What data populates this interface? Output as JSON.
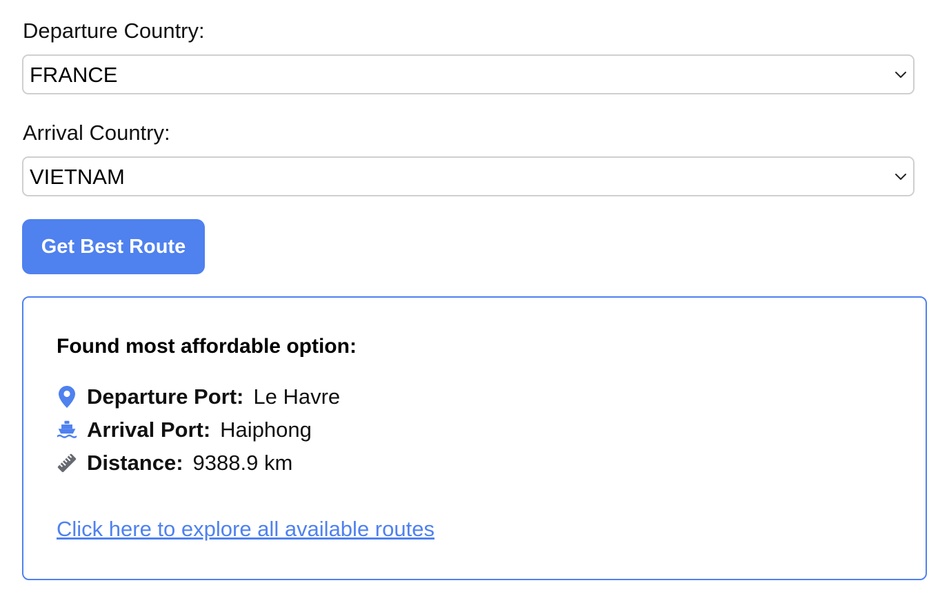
{
  "departure": {
    "label": "Departure Country:",
    "selected": "FRANCE"
  },
  "arrival": {
    "label": "Arrival Country:",
    "selected": "VIETNAM"
  },
  "actions": {
    "get_route_label": "Get Best Route"
  },
  "result": {
    "title": "Found most affordable option:",
    "departure_port": {
      "key": "Departure Port:",
      "value": "Le Havre",
      "icon": "map-pin-icon"
    },
    "arrival_port": {
      "key": "Arrival Port:",
      "value": "Haiphong",
      "icon": "ship-icon"
    },
    "distance": {
      "key": "Distance:",
      "value": "9388.9 km",
      "icon": "ruler-icon"
    },
    "explore_link": "Click here to explore all available routes"
  },
  "colors": {
    "accent": "#4f81ef",
    "ruler_icon": "#666a70",
    "select_border": "#cfcfcf"
  }
}
